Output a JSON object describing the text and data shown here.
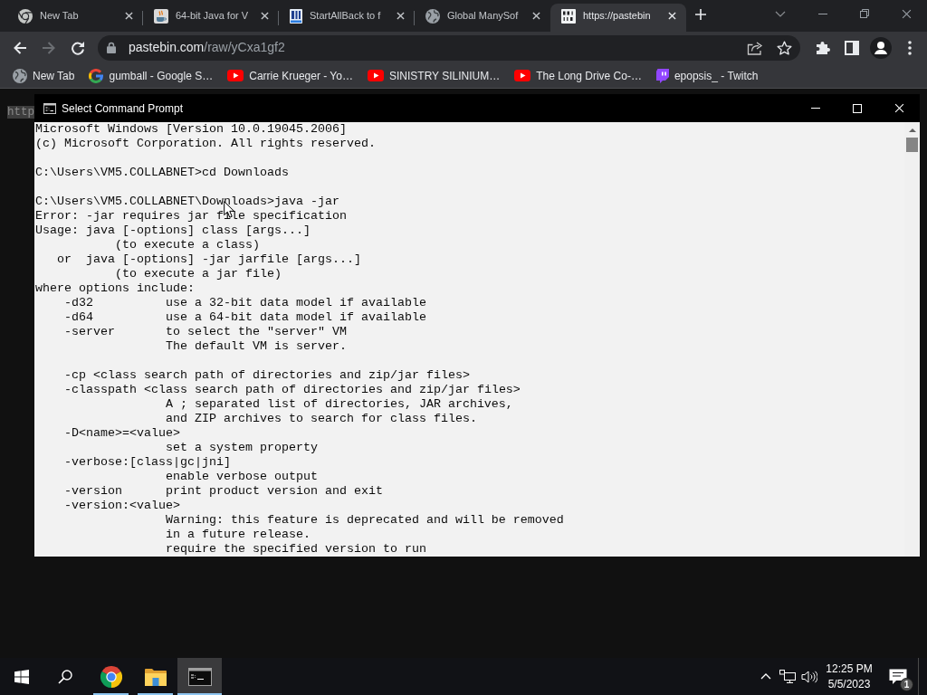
{
  "browser": {
    "tabs": [
      {
        "title": "New Tab",
        "kind": "chrome",
        "selected": false
      },
      {
        "title": "64-bit Java for V",
        "kind": "java",
        "selected": false
      },
      {
        "title": "StartAllBack to f",
        "kind": "document",
        "selected": false
      },
      {
        "title": "Global ManySof",
        "kind": "globe",
        "selected": false
      },
      {
        "title": "https://pastebin",
        "kind": "binary",
        "selected": true
      }
    ],
    "nav_buttons": [
      {
        "kind": "back",
        "disabled": false
      },
      {
        "kind": "forward",
        "disabled": true
      },
      {
        "kind": "reload",
        "disabled": false
      }
    ],
    "address": {
      "host": "pastebin.com",
      "path": "/raw/yCxa1gf2"
    },
    "bookmarks": [
      {
        "title": "New Tab",
        "kind": "globe"
      },
      {
        "title": "gumball - Google S…",
        "kind": "google"
      },
      {
        "title": "Carrie Krueger - Yo…",
        "kind": "youtube"
      },
      {
        "title": "SINISTRY SILINIUM…",
        "kind": "youtube"
      },
      {
        "title": "The Long Drive Co-…",
        "kind": "youtube"
      },
      {
        "title": "epopsis_ - Twitch",
        "kind": "twitch"
      }
    ],
    "page": {
      "text": "http",
      "selected": true
    }
  },
  "console_window": {
    "title": "Select Command Prompt",
    "blocks": [
      [
        "Microsoft Windows [Version 10.0.19045.2006]",
        "(c) Microsoft Corporation. All rights reserved."
      ],
      [
        "C:\\Users\\VM5.COLLABNET>cd Downloads"
      ],
      [
        "C:\\Users\\VM5.COLLABNET\\Downloads>java -jar",
        "Error: -jar requires jar file specification",
        "Usage: java [-options] class [args...]",
        "           (to execute a class)",
        "   or  java [-options] -jar jarfile [args...]",
        "           (to execute a jar file)",
        "where options include:",
        "    -d32          use a 32-bit data model if available",
        "    -d64          use a 64-bit data model if available",
        "    -server       to select the \"server\" VM",
        "                  The default VM is server."
      ],
      [
        "    -cp <class search path of directories and zip/jar files>",
        "    -classpath <class search path of directories and zip/jar files>",
        "                  A ; separated list of directories, JAR archives,",
        "                  and ZIP archives to search for class files.",
        "    -D<name>=<value>",
        "                  set a system property",
        "    -verbose:[class|gc|jni]",
        "                  enable verbose output",
        "    -version      print product version and exit",
        "    -version:<value>",
        "                  Warning: this feature is deprecated and will be removed",
        "                  in a future release.",
        "                  require the specified version to run"
      ]
    ]
  },
  "taskbar": {
    "apps": [
      {
        "kind": "chrome",
        "running": true,
        "selected": false
      },
      {
        "kind": "folder",
        "running": true,
        "selected": false
      },
      {
        "kind": "terminal",
        "running": true,
        "selected": true
      }
    ],
    "clock": {
      "time": "12:25 PM",
      "date": "5/5/2023"
    },
    "notifications": {
      "badge": "1"
    }
  }
}
